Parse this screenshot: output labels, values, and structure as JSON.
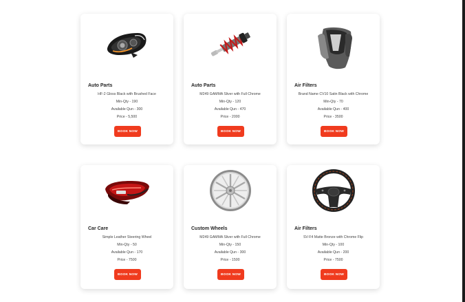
{
  "products": [
    {
      "category": "Auto Parts",
      "name": "HF-2 Gloss Black with Brushed Face",
      "min_qty": "Min-Qty - 190",
      "available": "Available Qun - 300",
      "price": "Price - 5,500",
      "button": "BOOK NOW",
      "icon": "headlight-icon"
    },
    {
      "category": "Auto Parts",
      "name": "M249 GAMMA Sliver with Full Chrome",
      "min_qty": "Min-Qty - 120",
      "available": "Available Qun - 470",
      "price": "Price - 2000",
      "button": "BOOK NOW",
      "icon": "shock-absorber-icon"
    },
    {
      "category": "Air Filters",
      "name": "Brand Name CV10 Satin Black with Chrome",
      "min_qty": "Min-Qty - 70",
      "available": "Available Qun - 400",
      "price": "Price - 3500",
      "button": "BOOK NOW",
      "icon": "hood-scoop-icon"
    },
    {
      "category": "Car Care",
      "name": "Simple Leather Steering Wheel",
      "min_qty": "Min-Qty - 50",
      "available": "Available Qun - 170",
      "price": "Price - 7500",
      "button": "BOOK NOW",
      "icon": "tail-light-icon"
    },
    {
      "category": "Custom Wheels",
      "name": "M249 GAMMA Sliver with Full Chrome",
      "min_qty": "Min-Qty - 150",
      "available": "Available Qun - 300",
      "price": "Price - 1500",
      "button": "BOOK NOW",
      "icon": "alloy-wheel-icon"
    },
    {
      "category": "Air Filters",
      "name": "SV-F4 Matte Bronze with Chrome Flip",
      "min_qty": "Min-Qty - 100",
      "available": "Available Qun - 200",
      "price": "Price - 7500",
      "button": "BOOK NOW",
      "icon": "steering-wheel-icon"
    }
  ],
  "colors": {
    "accent": "#f03b1e",
    "text": "#222222"
  }
}
